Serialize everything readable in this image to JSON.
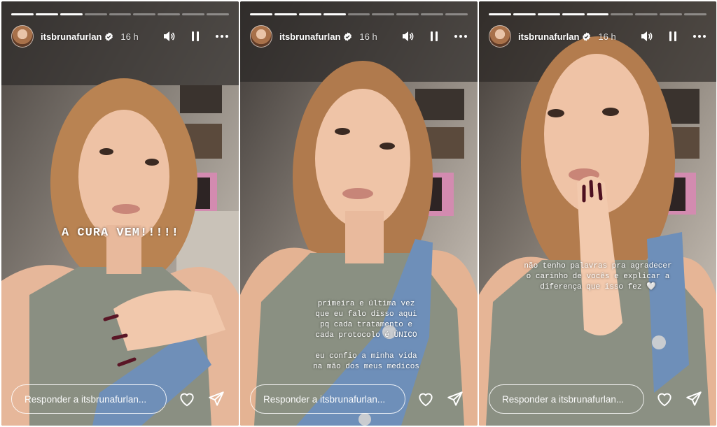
{
  "account": {
    "username": "itsbrunafurlan",
    "time_ago": "16 h"
  },
  "reply_placeholder": "Responder a itsbrunafurlan...",
  "icons": {
    "avatar": "avatar-image",
    "verified": "verified-badge-icon",
    "sound": "speaker-icon",
    "pause": "pause-icon",
    "more": "more-options-icon",
    "like": "heart-icon",
    "share": "send-icon"
  },
  "stories": [
    {
      "progress_done": 3,
      "progress_total": 9,
      "caption": "A CURA VEM!!!!!"
    },
    {
      "progress_done": 4,
      "progress_total": 9,
      "caption": "primeira e última vez\nque eu falo disso aqui\npq cada tratamento e\ncada protocolo é ÚNICO\n\neu confio a minha vida\nna mão dos meus medicos"
    },
    {
      "progress_done": 5,
      "progress_total": 9,
      "caption": "não tenho palavras pra agradecer\no carinho de vocês e explicar a\ndiferença que isso fez 🤍"
    }
  ]
}
